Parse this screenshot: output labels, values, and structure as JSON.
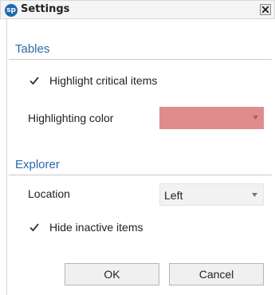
{
  "window": {
    "title": "Settings",
    "app_icon_text": "sp",
    "app_icon_color": "#1f67b1"
  },
  "tables": {
    "header": "Tables",
    "highlight_critical": {
      "label": "Highlight critical items",
      "checked": true
    },
    "highlighting_color": {
      "label": "Highlighting color",
      "value_color": "#e08c8c"
    }
  },
  "explorer": {
    "header": "Explorer",
    "location": {
      "label": "Location",
      "value": "Left"
    },
    "hide_inactive": {
      "label": "Hide inactive items",
      "checked": true
    }
  },
  "buttons": {
    "ok": "OK",
    "cancel": "Cancel"
  },
  "colors": {
    "section_header": "#2a69a8"
  }
}
